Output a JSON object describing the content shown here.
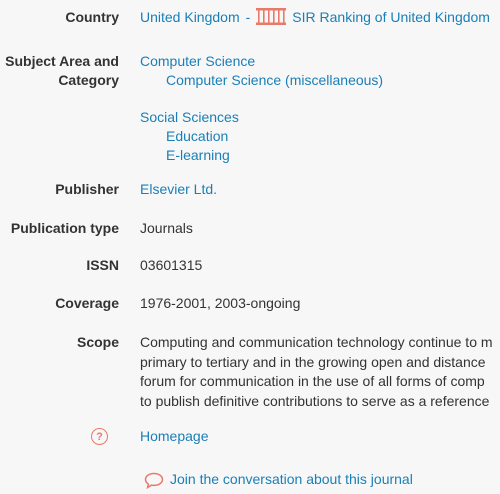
{
  "country": {
    "label": "Country",
    "value": "United Kingdom",
    "separator": "-",
    "sir_link": "SIR Ranking of United Kingdom"
  },
  "subject": {
    "label_line1": "Subject Area and",
    "label_line2": "Category",
    "area1": "Computer Science",
    "area1_cat1": "Computer Science (miscellaneous)",
    "area2": "Social Sciences",
    "area2_cat1": "Education",
    "area2_cat2": "E-learning"
  },
  "publisher": {
    "label": "Publisher",
    "value": "Elsevier Ltd."
  },
  "publication_type": {
    "label": "Publication type",
    "value": "Journals"
  },
  "issn": {
    "label": "ISSN",
    "value": "03601315"
  },
  "coverage": {
    "label": "Coverage",
    "value": "1976-2001, 2003-ongoing"
  },
  "scope": {
    "label": "Scope",
    "lines": [
      "Computing and communication technology continue to m",
      "primary to tertiary and in the growing open and distance",
      "forum for communication in the use of all forms of comp",
      "to publish definitive contributions to serve as a reference"
    ]
  },
  "homepage": {
    "label": "Homepage"
  },
  "conversation": {
    "label": "Join the conversation about this journal"
  },
  "colors": {
    "link": "#1a7fb8",
    "icon_accent": "#e87a6a",
    "background": "#f7f7f7"
  },
  "icons": {
    "sir": "sir-ranking-icon",
    "help": "help-circle-icon",
    "chat": "chat-bubble-icon"
  }
}
